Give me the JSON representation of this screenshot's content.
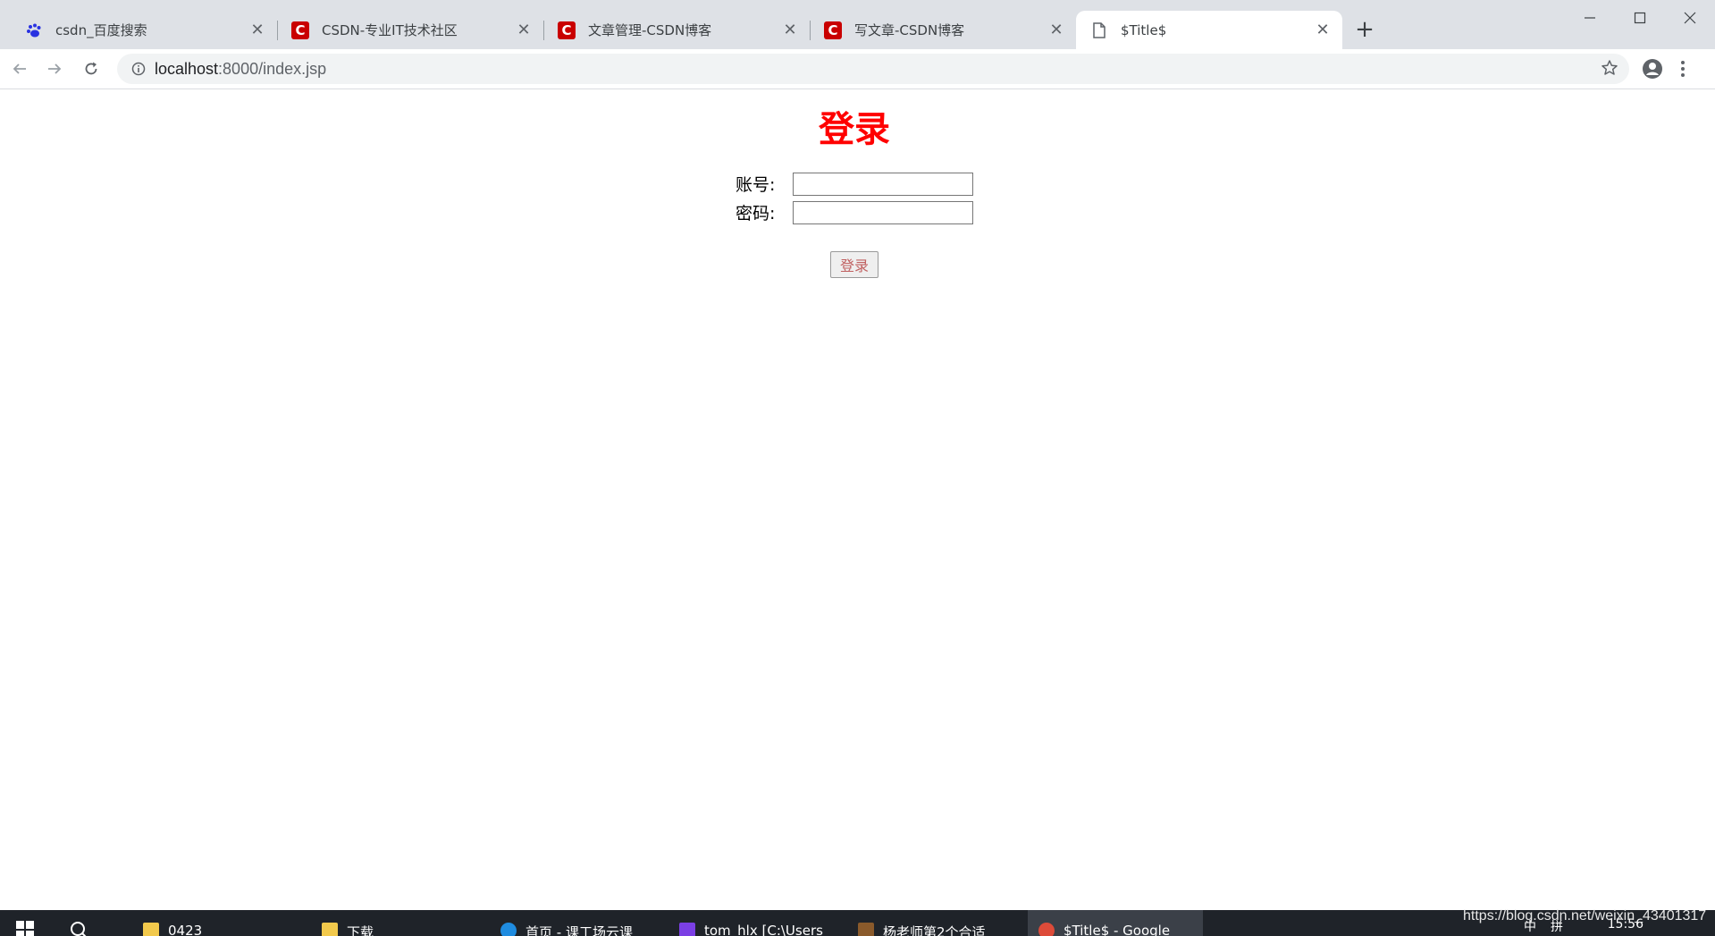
{
  "browser": {
    "tabs": [
      {
        "label": "csdn_百度搜索",
        "icon": "baidu-paw-icon",
        "active": false
      },
      {
        "label": "CSDN-专业IT技术社区",
        "icon": "csdn-logo-icon",
        "active": false
      },
      {
        "label": "文章管理-CSDN博客",
        "icon": "csdn-logo-icon",
        "active": false
      },
      {
        "label": "写文章-CSDN博客",
        "icon": "csdn-logo-icon",
        "active": false
      },
      {
        "label": "$Title$",
        "icon": "page-icon",
        "active": true
      }
    ],
    "csdn_logo_letter": "C",
    "close_glyph": "✕",
    "new_tab_glyph": "+",
    "url_host": "localhost",
    "url_rest": ":8000/index.jsp"
  },
  "page": {
    "title": "登录",
    "title_color": "#ff0000",
    "account_label": "账号:",
    "account_value": "",
    "password_label": "密码:",
    "password_value": "",
    "submit_label": "登录"
  },
  "taskbar": {
    "items": [
      {
        "label": "0423",
        "icon": "folder-icon"
      },
      {
        "label": "下载",
        "icon": "folder-icon"
      },
      {
        "label": "首页 - 课工场云课",
        "icon": "edge-icon"
      },
      {
        "label": "tom_hlx [C:\\Users",
        "icon": "intellij-icon"
      },
      {
        "label": "杨老师第2个合适",
        "icon": "app-icon"
      },
      {
        "label": "$Title$ - Google",
        "icon": "chrome-icon",
        "active": true
      }
    ],
    "tray_time": "15:56",
    "tray_lang": "中",
    "tray_ime": "拼"
  },
  "watermark": "https://blog.csdn.net/weixin_43401317"
}
